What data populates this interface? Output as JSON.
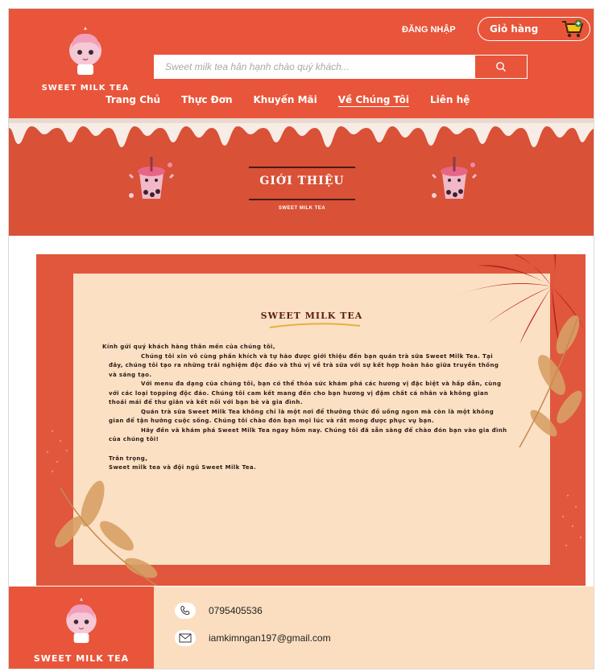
{
  "header": {
    "brand": "SWEET MILK TEA",
    "login": "ĐĂNG NHẬP",
    "cart_label": "Giỏ hàng",
    "search_placeholder": "Sweet milk tea hân hạnh chào quý khách...",
    "nav": [
      {
        "label": "Trang Chủ"
      },
      {
        "label": "Thực Đơn"
      },
      {
        "label": "Khuyến Mãi"
      },
      {
        "label": "Về Chúng Tôi",
        "active": true
      },
      {
        "label": "Liên hệ"
      }
    ]
  },
  "banner": {
    "title": "GIỚI THIỆU",
    "subtitle": "SWEET MILK TEA"
  },
  "letter": {
    "title": "SWEET MILK TEA",
    "greeting": "Kính gửi quý khách hàng thân mến của chúng tôi,",
    "paragraphs": [
      "Chúng tôi xin vô cùng phấn khích và tự hào được giới thiệu đến bạn quán trà sữa Sweet Milk Tea. Tại đây, chúng tôi tạo ra những trải nghiệm độc đáo và thú vị về trà sữa với sự kết hợp hoàn hảo giữa truyền thống và sáng tạo.",
      "Với menu đa dạng của chúng tôi, bạn có thể thỏa sức khám phá các hương vị đặc biệt và hấp dẫn, cùng với các loại topping độc đáo. Chúng tôi cam kết mang đến cho bạn hương vị đậm chất cá nhân và không gian thoải mái để thư giãn và kết nối với bạn bè và gia đình.",
      "Quán trà sữa Sweet Milk Tea không chỉ là một nơi để thưởng thức đồ uống ngon mà còn là một không gian để tận hưởng cuộc sống. Chúng tôi chào đón bạn mọi lúc và rất mong được phục vụ bạn.",
      "Hãy đến và khám phá Sweet Milk Tea ngay hôm nay. Chúng tôi đã sẵn sàng để chào đón bạn vào gia đình của chúng tôi!"
    ],
    "closing": "Trân trọng,",
    "signature": "Sweet milk tea và đội ngũ Sweet Milk Tea."
  },
  "footer": {
    "brand": "SWEET MILK TEA",
    "phone": "0795405536",
    "email": "iamkimngan197@gmail.com"
  },
  "colors": {
    "primary": "#e8553a",
    "banner": "#d95136",
    "paper": "#fbe0c4",
    "footer": "#fbdec0"
  },
  "icons": [
    "mascot-icon",
    "cart-icon",
    "search-icon",
    "phone-icon",
    "mail-icon"
  ]
}
